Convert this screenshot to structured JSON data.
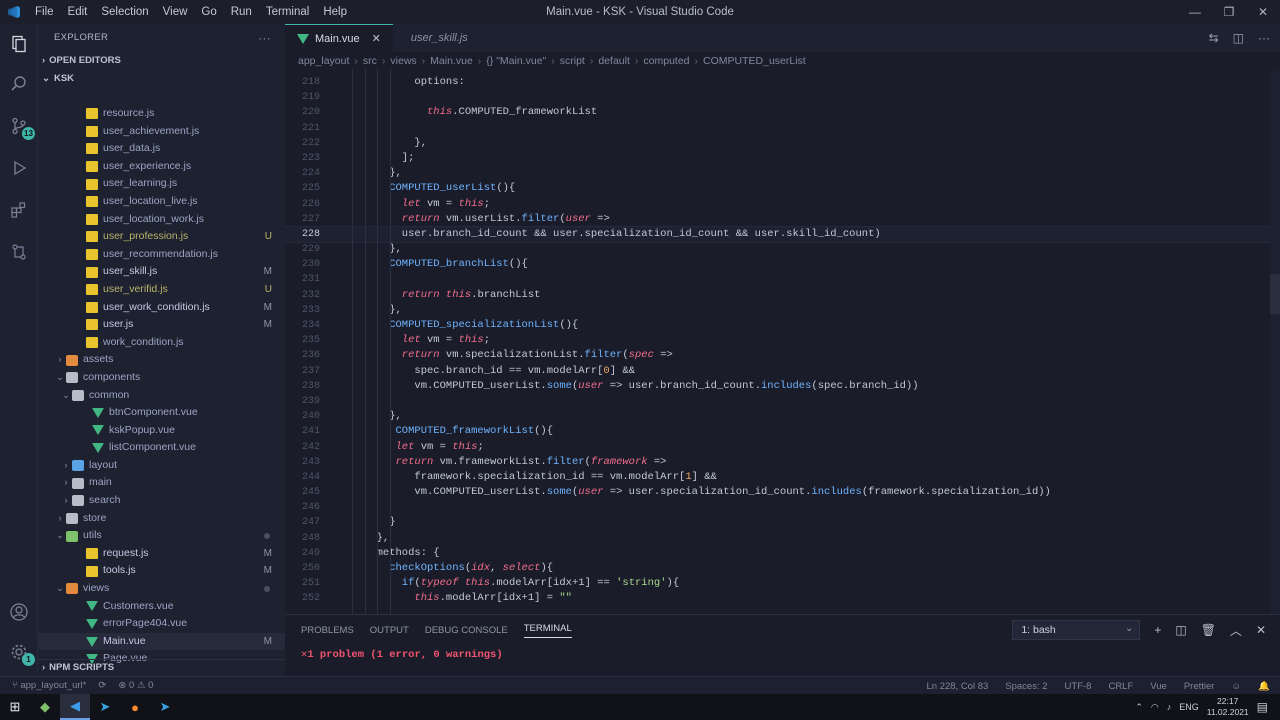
{
  "window": {
    "title": "Main.vue - KSK - Visual Studio Code",
    "menu": [
      "File",
      "Edit",
      "Selection",
      "View",
      "Go",
      "Run",
      "Terminal",
      "Help"
    ]
  },
  "activity": {
    "scm_badge": "13",
    "settings_badge": "1"
  },
  "sidebar": {
    "title": "EXPLORER",
    "open_editors": "OPEN EDITORS",
    "root": "KSK",
    "npm": "NPM SCRIPTS",
    "items": [
      {
        "label": "resource.js",
        "type": "js",
        "indent": 48,
        "status": ""
      },
      {
        "label": "user_achievement.js",
        "type": "js",
        "indent": 48,
        "status": ""
      },
      {
        "label": "user_data.js",
        "type": "js",
        "indent": 48,
        "status": ""
      },
      {
        "label": "user_experience.js",
        "type": "js",
        "indent": 48,
        "status": ""
      },
      {
        "label": "user_learning.js",
        "type": "js",
        "indent": 48,
        "status": ""
      },
      {
        "label": "user_location_live.js",
        "type": "js",
        "indent": 48,
        "status": ""
      },
      {
        "label": "user_location_work.js",
        "type": "js",
        "indent": 48,
        "status": ""
      },
      {
        "label": "user_profession.js",
        "type": "js",
        "indent": 48,
        "status": "U"
      },
      {
        "label": "user_recommendation.js",
        "type": "js",
        "indent": 48,
        "status": ""
      },
      {
        "label": "user_skill.js",
        "type": "js",
        "indent": 48,
        "status": "M"
      },
      {
        "label": "user_verifid.js",
        "type": "js",
        "indent": 48,
        "status": "U"
      },
      {
        "label": "user_work_condition.js",
        "type": "js",
        "indent": 48,
        "status": "M"
      },
      {
        "label": "user.js",
        "type": "js",
        "indent": 48,
        "status": "M"
      },
      {
        "label": "work_condition.js",
        "type": "js",
        "indent": 48,
        "status": ""
      },
      {
        "label": "assets",
        "type": "folder",
        "color": "o",
        "indent": 28,
        "chev": "›",
        "status": ""
      },
      {
        "label": "components",
        "type": "folder",
        "color": "",
        "indent": 28,
        "chev": "⌄",
        "status": ""
      },
      {
        "label": "common",
        "type": "folder",
        "color": "",
        "indent": 34,
        "chev": "⌄",
        "status": ""
      },
      {
        "label": "btnComponent.vue",
        "type": "vue",
        "indent": 54,
        "status": ""
      },
      {
        "label": "kskPopup.vue",
        "type": "vue",
        "indent": 54,
        "status": ""
      },
      {
        "label": "listComponent.vue",
        "type": "vue",
        "indent": 54,
        "status": ""
      },
      {
        "label": "layout",
        "type": "folder",
        "color": "b",
        "indent": 34,
        "chev": "›",
        "status": ""
      },
      {
        "label": "main",
        "type": "folder",
        "color": "",
        "indent": 34,
        "chev": "›",
        "status": ""
      },
      {
        "label": "search",
        "type": "folder",
        "color": "",
        "indent": 34,
        "chev": "›",
        "status": ""
      },
      {
        "label": "store",
        "type": "folder",
        "color": "",
        "indent": 28,
        "chev": "›",
        "status": ""
      },
      {
        "label": "utils",
        "type": "folder",
        "color": "g",
        "indent": 28,
        "chev": "⌄",
        "status": "dot"
      },
      {
        "label": "request.js",
        "type": "js",
        "indent": 48,
        "status": "M"
      },
      {
        "label": "tools.js",
        "type": "js",
        "indent": 48,
        "status": "M"
      },
      {
        "label": "views",
        "type": "folder",
        "color": "o",
        "indent": 28,
        "chev": "⌄",
        "status": "dot"
      },
      {
        "label": "Customers.vue",
        "type": "vue",
        "indent": 48,
        "status": ""
      },
      {
        "label": "errorPage404.vue",
        "type": "vue",
        "indent": 48,
        "status": ""
      },
      {
        "label": "Main.vue",
        "type": "vue",
        "indent": 48,
        "status": "M",
        "selected": true
      },
      {
        "label": "Page.vue",
        "type": "vue",
        "indent": 48,
        "status": ""
      }
    ]
  },
  "tabs": [
    {
      "label": "Main.vue",
      "active": true
    },
    {
      "label": "user_skill.js",
      "active": false
    }
  ],
  "breadcrumb": [
    "app_layout",
    "src",
    "views",
    "Main.vue",
    "{} \"Main.vue\"",
    "script",
    "default",
    "computed",
    "COMPUTED_userList"
  ],
  "code": {
    "current_line": 228,
    "lines": [
      {
        "n": 218,
        "i": 4,
        "h": [
          [
            "pun",
            "options:"
          ]
        ]
      },
      {
        "n": 219,
        "i": 0,
        "h": []
      },
      {
        "n": 220,
        "i": 5,
        "h": [
          [
            "this",
            "this"
          ],
          [
            "pun",
            ".COMPUTED_frameworkList"
          ]
        ]
      },
      {
        "n": 221,
        "i": 0,
        "h": []
      },
      {
        "n": 222,
        "i": 4,
        "h": [
          [
            "pun",
            "},"
          ]
        ]
      },
      {
        "n": 223,
        "i": 3,
        "h": [
          [
            "pun",
            "];"
          ]
        ]
      },
      {
        "n": 224,
        "i": 2,
        "h": [
          [
            "pun",
            "},"
          ]
        ]
      },
      {
        "n": 225,
        "i": 2,
        "h": [
          [
            "fn",
            "COMPUTED_userList"
          ],
          [
            "pun",
            "(){"
          ]
        ]
      },
      {
        "n": 226,
        "i": 3,
        "h": [
          [
            "kw",
            "let"
          ],
          [
            "pun",
            " vm = "
          ],
          [
            "this",
            "this"
          ],
          [
            "pun",
            ";"
          ]
        ]
      },
      {
        "n": 227,
        "i": 3,
        "h": [
          [
            "kw",
            "return"
          ],
          [
            "pun",
            " vm.userList."
          ],
          [
            "fn",
            "filter"
          ],
          [
            "pun",
            "("
          ],
          [
            "kw",
            "user"
          ],
          [
            "pun",
            " =>"
          ]
        ]
      },
      {
        "n": 228,
        "i": 3,
        "h": [
          [
            "pun",
            "user.branch_id_count && user.specialization_id_count && user.skill_id_count)"
          ]
        ]
      },
      {
        "n": 229,
        "i": 2,
        "h": [
          [
            "pun",
            "},"
          ]
        ]
      },
      {
        "n": 230,
        "i": 2,
        "h": [
          [
            "fn",
            "COMPUTED_branchList"
          ],
          [
            "pun",
            "(){"
          ]
        ]
      },
      {
        "n": 231,
        "i": 0,
        "h": []
      },
      {
        "n": 232,
        "i": 3,
        "h": [
          [
            "kw",
            "return"
          ],
          [
            "pun",
            " "
          ],
          [
            "this",
            "this"
          ],
          [
            "pun",
            ".branchList"
          ]
        ]
      },
      {
        "n": 233,
        "i": 2,
        "h": [
          [
            "pun",
            "},"
          ]
        ]
      },
      {
        "n": 234,
        "i": 2,
        "h": [
          [
            "fn",
            "COMPUTED_specializationList"
          ],
          [
            "pun",
            "(){"
          ]
        ]
      },
      {
        "n": 235,
        "i": 3,
        "h": [
          [
            "kw",
            "let"
          ],
          [
            "pun",
            " vm = "
          ],
          [
            "this",
            "this"
          ],
          [
            "pun",
            ";"
          ]
        ]
      },
      {
        "n": 236,
        "i": 3,
        "h": [
          [
            "kw",
            "return"
          ],
          [
            "pun",
            " vm.specializationList."
          ],
          [
            "fn",
            "filter"
          ],
          [
            "pun",
            "("
          ],
          [
            "kw",
            "spec"
          ],
          [
            "pun",
            " =>"
          ]
        ]
      },
      {
        "n": 237,
        "i": 4,
        "h": [
          [
            "pun",
            "spec.branch_id == vm.modelArr["
          ],
          [
            "num2",
            "0"
          ],
          [
            "pun",
            "] &&"
          ]
        ]
      },
      {
        "n": 238,
        "i": 4,
        "h": [
          [
            "pun",
            "vm.COMPUTED_userList."
          ],
          [
            "fn",
            "some"
          ],
          [
            "pun",
            "("
          ],
          [
            "kw",
            "user"
          ],
          [
            "pun",
            " => user.branch_id_count."
          ],
          [
            "fn",
            "includes"
          ],
          [
            "pun",
            "(spec.branch_id))"
          ]
        ]
      },
      {
        "n": 239,
        "i": 0,
        "h": []
      },
      {
        "n": 240,
        "i": 2,
        "h": [
          [
            "pun",
            "},"
          ]
        ]
      },
      {
        "n": 241,
        "i": 2,
        "h": [
          [
            "pun",
            " "
          ],
          [
            "fn",
            "COMPUTED_frameworkList"
          ],
          [
            "pun",
            "(){"
          ]
        ]
      },
      {
        "n": 242,
        "i": 2,
        "h": [
          [
            "pun",
            " "
          ],
          [
            "kw",
            "let"
          ],
          [
            "pun",
            " vm = "
          ],
          [
            "this",
            "this"
          ],
          [
            "pun",
            ";"
          ]
        ]
      },
      {
        "n": 243,
        "i": 2,
        "h": [
          [
            "pun",
            " "
          ],
          [
            "kw",
            "return"
          ],
          [
            "pun",
            " vm.frameworkList."
          ],
          [
            "fn",
            "filter"
          ],
          [
            "pun",
            "("
          ],
          [
            "kw",
            "framework"
          ],
          [
            "pun",
            " =>"
          ]
        ]
      },
      {
        "n": 244,
        "i": 4,
        "h": [
          [
            "pun",
            "framework.specialization_id == vm.modelArr["
          ],
          [
            "num2",
            "1"
          ],
          [
            "pun",
            "] &&"
          ]
        ]
      },
      {
        "n": 245,
        "i": 4,
        "h": [
          [
            "pun",
            "vm.COMPUTED_userList."
          ],
          [
            "fn",
            "some"
          ],
          [
            "pun",
            "("
          ],
          [
            "kw",
            "user"
          ],
          [
            "pun",
            " => user.specialization_id_count."
          ],
          [
            "fn",
            "includes"
          ],
          [
            "pun",
            "(framework.specialization_id))"
          ]
        ]
      },
      {
        "n": 246,
        "i": 0,
        "h": []
      },
      {
        "n": 247,
        "i": 2,
        "h": [
          [
            "pun",
            "}"
          ]
        ]
      },
      {
        "n": 248,
        "i": 1,
        "h": [
          [
            "pun",
            "},"
          ]
        ]
      },
      {
        "n": 249,
        "i": 1,
        "h": [
          [
            "pun",
            "methods: {"
          ]
        ]
      },
      {
        "n": 250,
        "i": 2,
        "h": [
          [
            "fn",
            "checkOptions"
          ],
          [
            "pun",
            "("
          ],
          [
            "kw",
            "idx"
          ],
          [
            "pun",
            ", "
          ],
          [
            "kw",
            "select"
          ],
          [
            "pun",
            "){"
          ]
        ]
      },
      {
        "n": 251,
        "i": 3,
        "h": [
          [
            "fn",
            "if"
          ],
          [
            "pun",
            "("
          ],
          [
            "kw",
            "typeof"
          ],
          [
            "pun",
            " "
          ],
          [
            "this",
            "this"
          ],
          [
            "pun",
            ".modelArr[idx+1] == "
          ],
          [
            "str",
            "'string'"
          ],
          [
            "pun",
            "){"
          ]
        ]
      },
      {
        "n": 252,
        "i": 4,
        "h": [
          [
            "this",
            "this"
          ],
          [
            "pun",
            ".modelArr[idx+1] = "
          ],
          [
            "str",
            "\"\""
          ]
        ]
      }
    ]
  },
  "panel": {
    "tabs": [
      "PROBLEMS",
      "OUTPUT",
      "DEBUG CONSOLE",
      "TERMINAL"
    ],
    "active_tab": "TERMINAL",
    "terminal_select": "1: bash",
    "message": "1 problem (1 error, 0 warnings)"
  },
  "status": {
    "branch": "app_layout_url*",
    "errors": "0",
    "warnings": "0",
    "position": "Ln 228, Col 83",
    "spaces": "Spaces: 2",
    "encoding": "UTF-8",
    "eol": "CRLF",
    "language": "Vue",
    "formatter": "Prettier"
  },
  "taskbar": {
    "lang": "ENG",
    "time": "22:17",
    "date": "11.02.2021"
  }
}
